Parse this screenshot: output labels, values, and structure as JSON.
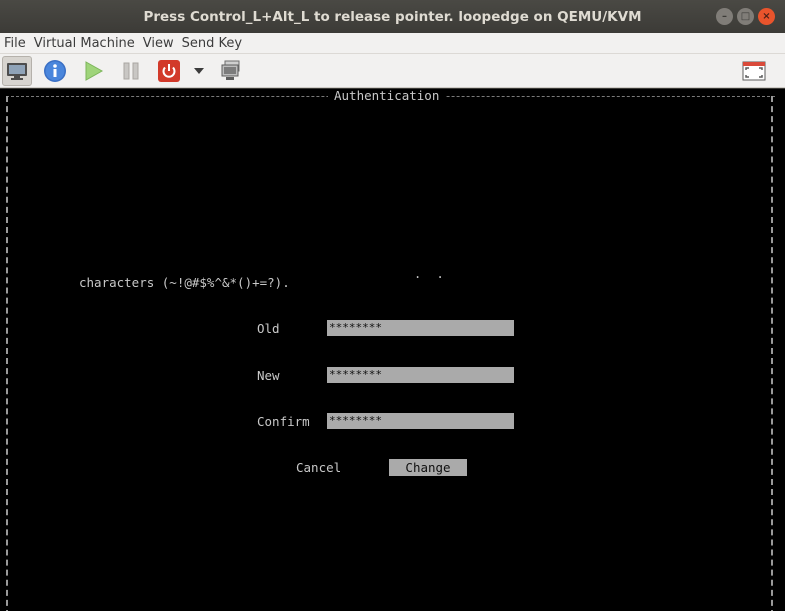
{
  "window": {
    "title": "Press Control_L+Alt_L to release pointer. loopedge on QEMU/KVM",
    "minimize_glyph": "–",
    "maximize_glyph": "□",
    "close_glyph": "×"
  },
  "menubar": {
    "items": [
      "File",
      "Virtual Machine",
      "View",
      "Send Key"
    ]
  },
  "toolbar": {
    "icons": [
      "monitor-icon",
      "info-icon",
      "play-icon",
      "pause-icon",
      "power-icon",
      "dropdown-arrow-icon",
      "snapshot-icon",
      "fullscreen-icon"
    ]
  },
  "console": {
    "dialog_title": "Authentication",
    "dots": ". .",
    "password_rule": "characters (~!@#$%^&*()+=?).",
    "fields": {
      "old_label": "Old",
      "old_value": "********",
      "new_label": "New",
      "new_value": "********",
      "confirm_label": "Confirm",
      "confirm_value": "********"
    },
    "buttons": {
      "cancel": "Cancel",
      "change": "Change"
    }
  },
  "colors": {
    "titlebar": "#3c3b37",
    "close_button": "#e9542c",
    "console_bg": "#000000",
    "field_bg": "#aaaaaa"
  }
}
